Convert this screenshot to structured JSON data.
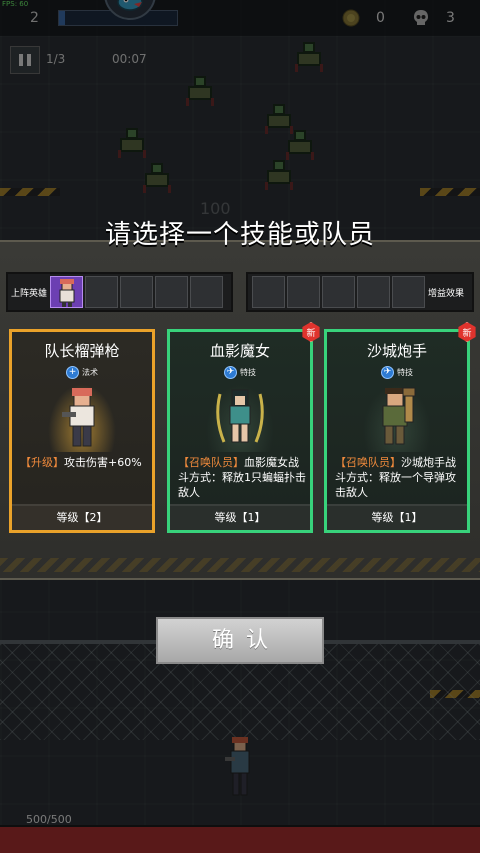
{
  "hud": {
    "fps_label": "FPS: 60",
    "level": "2",
    "xp_fraction": 0.05,
    "coins": "0",
    "kills": "3",
    "wave": "1/3",
    "timer": "00:07",
    "bg_score": "100"
  },
  "dialog": {
    "title": "请选择一个技能或队员",
    "left_slots_label": "上阵英雄",
    "right_slots_label": "增益效果",
    "confirm_label": "确认"
  },
  "cards": [
    {
      "name": "队长榴弹枪",
      "tag": "法术",
      "desc_highlight": "【升级】",
      "desc_text": "攻击伤害+60%",
      "level": "等级【2】",
      "is_new": false,
      "border_color": "#eaa22a"
    },
    {
      "name": "血影魔女",
      "tag": "特技",
      "desc_highlight": "【召唤队员】",
      "desc_text": "血影魔女战斗方式：释放1只蝙蝠扑击敌人",
      "level": "等级【1】",
      "is_new": true,
      "new_label": "新",
      "border_color": "#38d27b"
    },
    {
      "name": "沙城炮手",
      "tag": "特技",
      "desc_highlight": "【召唤队员】",
      "desc_text": "沙城炮手战斗方式：释放一个导弹攻击敌人",
      "level": "等级【1】",
      "is_new": true,
      "new_label": "新",
      "border_color": "#38d27b"
    }
  ],
  "player": {
    "hp_text": "500/500",
    "hp_fraction": 1.0
  },
  "colors": {
    "accent_gold": "#eaa22a",
    "accent_green": "#38d27b",
    "highlight_orange": "#f08a3c",
    "new_badge_red": "#e0332d"
  }
}
